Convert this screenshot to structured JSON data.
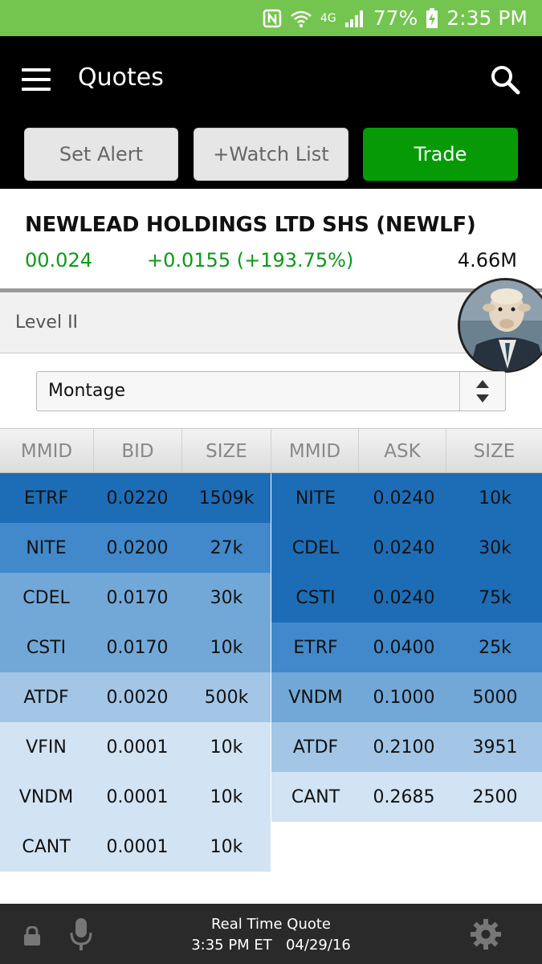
{
  "status_bar": {
    "battery": "77%",
    "time": "2:35 PM",
    "network": "4G"
  },
  "app_bar": {
    "title": "Quotes",
    "menu_icon": "hamburger-icon",
    "search_icon": "search-icon"
  },
  "actions": {
    "set_alert": "Set Alert",
    "watch_list": "+Watch List",
    "trade": "Trade",
    "trade_color": "#069b06"
  },
  "quote": {
    "name": "NEWLEAD HOLDINGS LTD SHS (NEWLF)",
    "last": "00.024",
    "change": "+0.0155 (+193.75%)",
    "volume": "4.66M",
    "change_color": "#0a9a16"
  },
  "level2": {
    "label": "Level II",
    "select_value": "Montage"
  },
  "table": {
    "headers": [
      "MMID",
      "BID",
      "SIZE",
      "MMID",
      "ASK",
      "SIZE"
    ],
    "bids": [
      {
        "mmid": "ETRF",
        "price": "0.0220",
        "size": "1509k",
        "color": "#1d6db6"
      },
      {
        "mmid": "NITE",
        "price": "0.0200",
        "size": "27k",
        "color": "#4189cb"
      },
      {
        "mmid": "CDEL",
        "price": "0.0170",
        "size": "30k",
        "color": "#72a8d8"
      },
      {
        "mmid": "CSTI",
        "price": "0.0170",
        "size": "10k",
        "color": "#72a8d8"
      },
      {
        "mmid": "ATDF",
        "price": "0.0020",
        "size": "500k",
        "color": "#a3c6e6"
      },
      {
        "mmid": "VFIN",
        "price": "0.0001",
        "size": "10k",
        "color": "#d2e3f3"
      },
      {
        "mmid": "VNDM",
        "price": "0.0001",
        "size": "10k",
        "color": "#d2e3f3"
      },
      {
        "mmid": "CANT",
        "price": "0.0001",
        "size": "10k",
        "color": "#d2e3f3"
      }
    ],
    "asks": [
      {
        "mmid": "NITE",
        "price": "0.0240",
        "size": "10k",
        "color": "#1d6db6"
      },
      {
        "mmid": "CDEL",
        "price": "0.0240",
        "size": "30k",
        "color": "#1d6db6"
      },
      {
        "mmid": "CSTI",
        "price": "0.0240",
        "size": "75k",
        "color": "#1d6db6"
      },
      {
        "mmid": "ETRF",
        "price": "0.0400",
        "size": "25k",
        "color": "#4189cb"
      },
      {
        "mmid": "VNDM",
        "price": "0.1000",
        "size": "5000",
        "color": "#72a8d8"
      },
      {
        "mmid": "ATDF",
        "price": "0.2100",
        "size": "3951",
        "color": "#a3c6e6"
      },
      {
        "mmid": "CANT",
        "price": "0.2685",
        "size": "2500",
        "color": "#d2e3f3"
      }
    ]
  },
  "bottom_bar": {
    "title": "Real Time Quote",
    "timestamp": "3:35 PM ET   04/29/16",
    "lock_icon": "lock-icon",
    "mic_icon": "microphone-icon",
    "settings_icon": "gear-icon"
  }
}
